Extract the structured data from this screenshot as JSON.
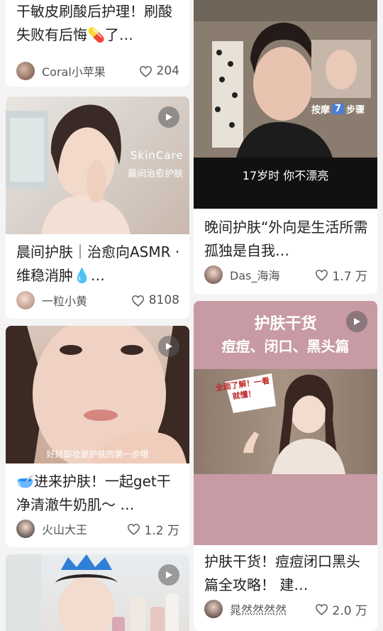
{
  "colors": {
    "heart": "#555555",
    "banner_pink": "#c79aa4",
    "title_text": "#222222"
  },
  "cards": [
    {
      "title": "干敏皮刷酸后护理！刷酸失败有后悔💊了…",
      "author": "Coral小苹果",
      "likes": "204"
    },
    {
      "title": "晨间护肤｜治愈向ASMR · 维稳消肿💧…",
      "author": "一粒小黄",
      "likes": "8108",
      "overlay_en": "SkinCare",
      "overlay_cn": "晨间治愈护肤"
    },
    {
      "title": "🥣进来护肤！一起get干净清澈牛奶肌～ …",
      "author": "火山大王",
      "likes": "1.2 万",
      "caption": "好好卸妆是护肤的第一步哦"
    },
    {
      "title": "",
      "author": "",
      "likes": ""
    },
    {
      "title": "晚间护肤“外向是生活所需 孤独是自我…",
      "author": "Das_海海",
      "likes": "1.7 万",
      "subtitle": "17岁时 你不漂亮",
      "badge_pre": "按摩",
      "badge_num": "7",
      "badge_post": "步骤"
    },
    {
      "title": "护肤干货！痘痘闭口黑头篇全攻略！ 建…",
      "author": "晁然然然然",
      "likes": "2.0 万",
      "banner_line1": "护肤干货",
      "banner_line2": "痘痘、闭口、黑头篇",
      "bubble": "全面了解！一看就懂！"
    }
  ]
}
